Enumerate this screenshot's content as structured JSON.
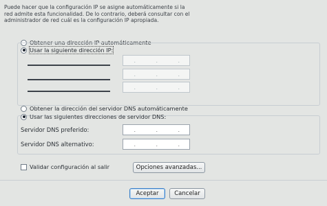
{
  "description_lines": [
    "Puede hacer que la configuración IP se asigne automáticamente si la",
    "red admite esta funcionalidad. De lo contrario, deberá consultar con el",
    "administrador de red cuál es la configuración IP apropiada."
  ],
  "ip": {
    "auto_label": "Obtener una dirección IP automáticamente",
    "manual_label": "Usar la siguiente dirección IP:",
    "selected": "manual"
  },
  "dns": {
    "auto_label": "Obtener la dirección del servidor DNS automáticamente",
    "manual_label": "Usar las siguientes direcciones de servidor DNS:",
    "preferred_label": "Servidor DNS preferido:",
    "alternate_label": "Servidor DNS alternativo:",
    "selected": "manual"
  },
  "ip_dots": ".",
  "validate_label": "Validar configuración al salir",
  "advanced_button": "Opciones avanzadas...",
  "ok_button": "Aceptar",
  "cancel_button": "Cancelar"
}
